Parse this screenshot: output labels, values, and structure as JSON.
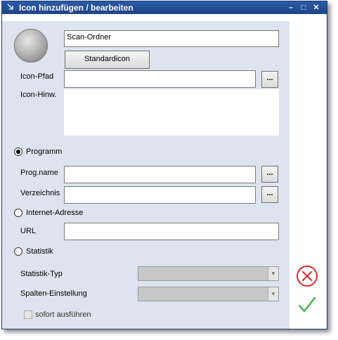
{
  "window": {
    "title": "Icon hinzufügen / bearbeiten",
    "controls": {
      "minimize": "–",
      "maximize": "□",
      "close": "✕"
    }
  },
  "icon_preview": {
    "name_value": "Scan-Ordner",
    "standard_button": "Standardicon"
  },
  "fields": {
    "icon_path_label": "Icon-Pfad",
    "icon_path_value": "",
    "icon_hint_label": "Icon-Hinw.",
    "icon_hint_value": "",
    "browse_label": "..."
  },
  "program": {
    "radio_label": "Programm",
    "selected": true,
    "prog_name_label": "Prog.name",
    "prog_name_value": "",
    "directory_label": "Verzeichnis",
    "directory_value": ""
  },
  "internet": {
    "radio_label": "Internet-Adresse",
    "selected": false,
    "url_label": "URL",
    "url_value": ""
  },
  "statistics": {
    "radio_label": "Statistik",
    "selected": false,
    "type_label": "Statistik-Typ",
    "type_value": "",
    "column_label": "Spalten-Einstellung",
    "column_value": "",
    "run_now_label": "sofort ausführen",
    "run_now_checked": false
  },
  "actions": {
    "cancel_icon": "cancel-icon",
    "confirm_icon": "checkmark-icon",
    "cancel_color": "#e0262b",
    "confirm_color": "#3fb24a"
  }
}
